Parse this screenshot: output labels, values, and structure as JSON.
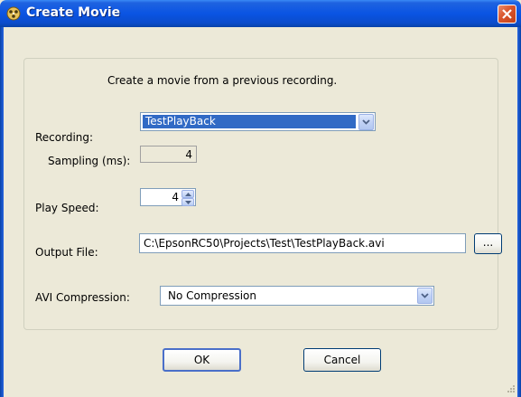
{
  "window": {
    "title": "Create Movie"
  },
  "description": "Create a movie from a previous recording.",
  "recording": {
    "label": "Recording:",
    "selected": "TestPlayBack"
  },
  "sampling": {
    "label": "Sampling (ms):",
    "value": "4"
  },
  "play_speed": {
    "label": "Play Speed:",
    "value": "4"
  },
  "output_file": {
    "label": "Output File:",
    "value": "C:\\EpsonRC50\\Projects\\Test\\TestPlayBack.avi",
    "browse_label": "..."
  },
  "avi_compression": {
    "label": "AVI Compression:",
    "selected": "No Compression"
  },
  "buttons": {
    "ok_label": "OK",
    "cancel_label": "Cancel"
  },
  "colors": {
    "titlebar": "#0a54e3",
    "selection": "#316ac5",
    "dialog_bg": "#ece9d8",
    "close_button": "#d9542b"
  },
  "icons": {
    "app": "movie-app-icon",
    "close": "close-icon",
    "dropdown": "chevron-down-icon",
    "spin_up": "spin-up-icon",
    "spin_down": "spin-down-icon"
  }
}
